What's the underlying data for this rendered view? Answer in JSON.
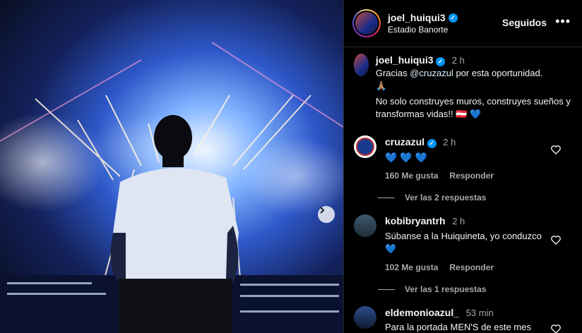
{
  "post": {
    "username": "joel_huiqui3",
    "location": "Estadio Banorte",
    "follow_label": "Seguidos",
    "more_icon": "more-horizontal-icon",
    "next_icon": "chevron-right-icon"
  },
  "caption": {
    "username": "joel_huiqui3",
    "time": "2 h",
    "line1_prefix": "Gracias ",
    "mention": "@cruzazul",
    "line1_suffix": " por esta oportunidad.",
    "line2_emoji": "🙏🏽",
    "line3": "No solo construyes muros, construyes sueños y transformas vidas!! ",
    "line3_emoji": "🇦🇹",
    "line3_heart": "💙"
  },
  "comments": [
    {
      "username": "cruzazul",
      "verified": true,
      "time": "2 h",
      "text": "💙 💙 💙",
      "likes": "160 Me gusta",
      "reply_label": "Responder",
      "view_replies": "Ver las 2 respuestas"
    },
    {
      "username": "kobibryantrh",
      "time": "2 h",
      "text": "Súbanse a la Huiquineta, yo conduzco",
      "text_heart": "💙",
      "likes": "102 Me gusta",
      "reply_label": "Responder",
      "view_replies": "Ver las 1 respuestas"
    },
    {
      "username": "eldemonioazul_",
      "time": "53 min",
      "text": "Para la portada MEN'S de este mes"
    }
  ],
  "colors": {
    "verified": "#0095f6",
    "panel_bg": "#000000",
    "muted": "#a8a8a8"
  }
}
